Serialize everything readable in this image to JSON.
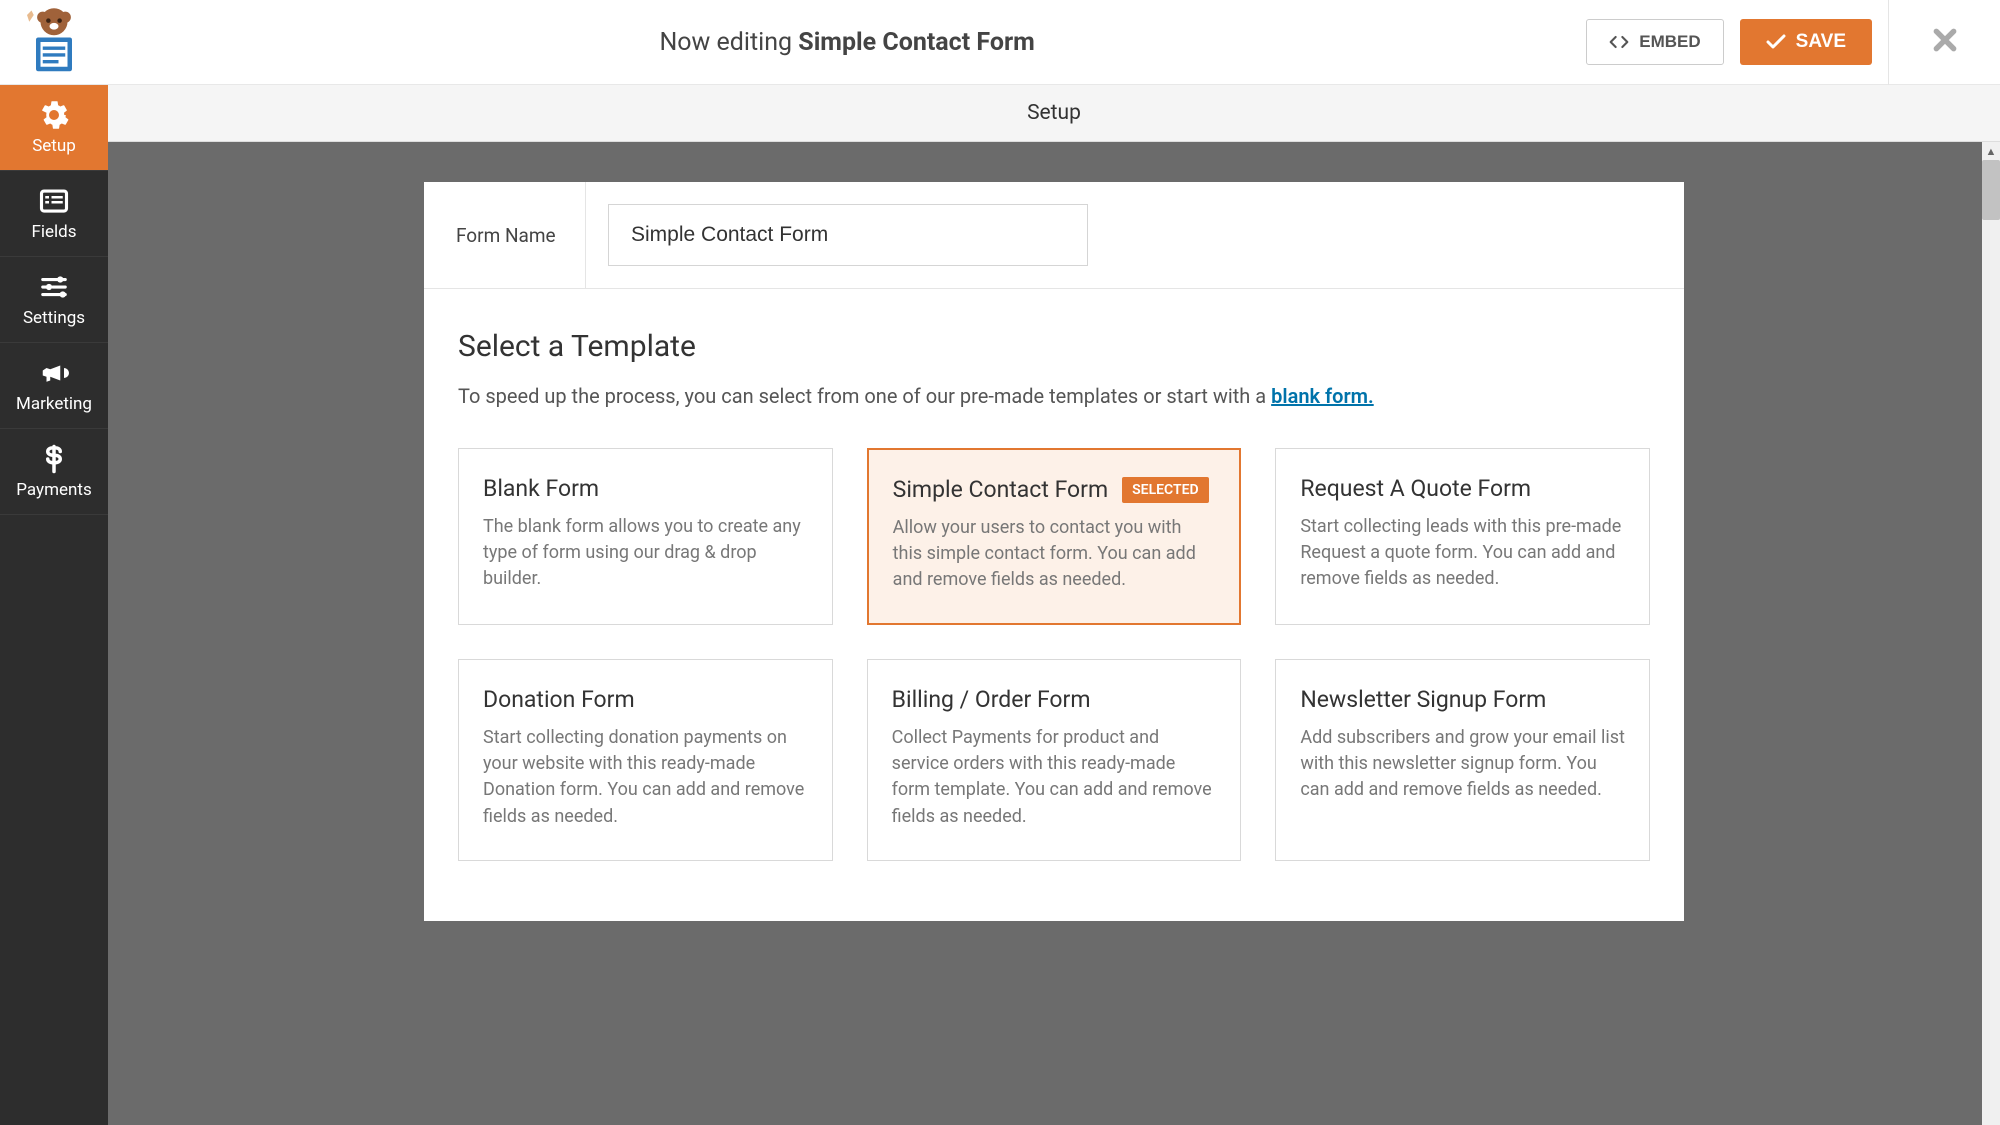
{
  "header": {
    "editing_prefix": "Now editing ",
    "form_name": "Simple Contact Form",
    "embed_label": "EMBED",
    "save_label": "SAVE"
  },
  "sidebar": {
    "items": [
      {
        "id": "setup",
        "label": "Setup",
        "active": true
      },
      {
        "id": "fields",
        "label": "Fields",
        "active": false
      },
      {
        "id": "settings",
        "label": "Settings",
        "active": false
      },
      {
        "id": "marketing",
        "label": "Marketing",
        "active": false
      },
      {
        "id": "payments",
        "label": "Payments",
        "active": false
      }
    ]
  },
  "subheader": {
    "title": "Setup"
  },
  "form_name_section": {
    "label": "Form Name",
    "value": "Simple Contact Form"
  },
  "template_section": {
    "heading": "Select a Template",
    "desc_prefix": "To speed up the process, you can select from one of our pre-made templates or start with a ",
    "desc_link": "blank form."
  },
  "selected_badge": "SELECTED",
  "templates": [
    {
      "name": "Blank Form",
      "desc": "The blank form allows you to create any type of form using our drag & drop builder.",
      "selected": false
    },
    {
      "name": "Simple Contact Form",
      "desc": "Allow your users to contact you with this simple contact form. You can add and remove fields as needed.",
      "selected": true
    },
    {
      "name": "Request A Quote Form",
      "desc": "Start collecting leads with this pre-made Request a quote form. You can add and remove fields as needed.",
      "selected": false
    },
    {
      "name": "Donation Form",
      "desc": "Start collecting donation payments on your website with this ready-made Donation form. You can add and remove fields as needed.",
      "selected": false
    },
    {
      "name": "Billing / Order Form",
      "desc": "Collect Payments for product and service orders with this ready-made form template. You can add and remove fields as needed.",
      "selected": false
    },
    {
      "name": "Newsletter Signup Form",
      "desc": "Add subscribers and grow your email list with this newsletter signup form. You can add and remove fields as needed.",
      "selected": false
    }
  ],
  "colors": {
    "accent": "#e27730"
  }
}
